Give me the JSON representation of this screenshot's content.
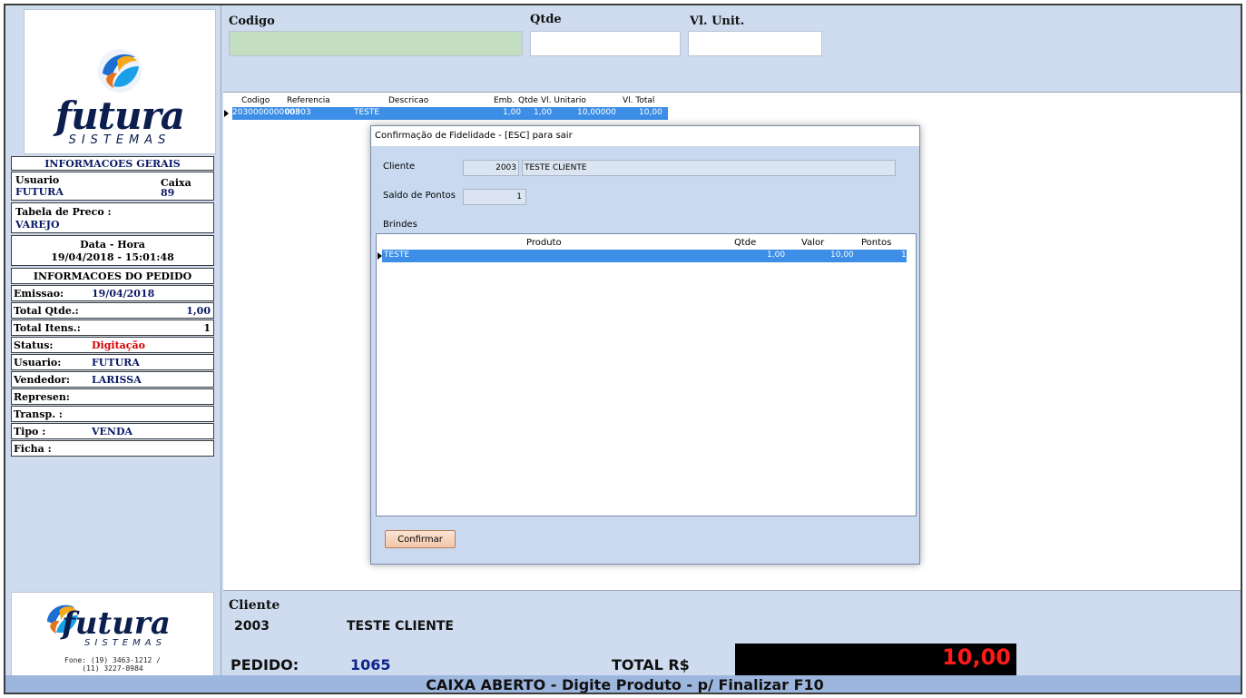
{
  "brand": {
    "name": "futura",
    "tagline": "SISTEMAS",
    "phone": "Fone: (19) 3463-1212 /",
    "phone2": "(11) 3227-8984"
  },
  "info_gerais": {
    "title": "INFORMACOES GERAIS",
    "usuario_label": "Usuario",
    "usuario": "FUTURA",
    "caixa_label": "Caixa",
    "caixa": "89",
    "tabela_label": "Tabela de Preco :",
    "tabela": "VAREJO",
    "datahora_label": "Data - Hora",
    "datahora": "19/04/2018 - 15:01:48"
  },
  "info_pedido": {
    "title": "INFORMACOES DO PEDIDO",
    "rows": [
      {
        "label": "Emissao:",
        "value": "19/04/2018"
      },
      {
        "label": "Total Qtde.:",
        "value": "1,00"
      },
      {
        "label": "Total Itens.:",
        "value": "1"
      },
      {
        "label": "Status:",
        "value": "Digitação"
      },
      {
        "label": "Usuario:",
        "value": "FUTURA"
      },
      {
        "label": "Vendedor:",
        "value": "LARISSA"
      },
      {
        "label": "Represen:",
        "value": ""
      },
      {
        "label": "Transp. :",
        "value": ""
      },
      {
        "label": "Tipo :",
        "value": "VENDA"
      },
      {
        "label": "Ficha :",
        "value": ""
      }
    ]
  },
  "entry": {
    "codigo_label": "Codigo",
    "qtde_label": "Qtde",
    "vlunit_label": "Vl. Unit.",
    "codigo": "",
    "qtde": "",
    "vlunit": ""
  },
  "grid": {
    "headers": [
      "Codigo",
      "Referencia",
      "Descricao",
      "Emb.",
      "Qtde",
      "Vl. Unitario",
      "Vl. Total"
    ],
    "row": {
      "codigo": "2030000000003",
      "referencia": "00003",
      "descricao": "TESTE",
      "emb": "1,00",
      "qtde": "1,00",
      "vl_unitario": "10,00000",
      "vl_total": "10,00"
    }
  },
  "dialog": {
    "title": "Confirmação de Fidelidade - [ESC] para sair",
    "cliente_label": "Cliente",
    "cliente_codigo": "2003",
    "cliente_nome": "TESTE CLIENTE",
    "saldo_label": "Saldo de Pontos",
    "saldo": "1",
    "brindes_label": "Brindes",
    "table_headers": [
      "Produto",
      "Qtde",
      "Valor",
      "Pontos"
    ],
    "table_row": {
      "produto": "TESTE",
      "qtde": "1,00",
      "valor": "10,00",
      "pontos": "1"
    },
    "confirm_label": "Confirmar"
  },
  "footer": {
    "cliente_label": "Cliente",
    "cliente_codigo": "2003",
    "cliente_nome": "TESTE CLIENTE",
    "pedido_label": "PEDIDO:",
    "pedido": "1065",
    "total_label": "TOTAL R$",
    "total": "10,00",
    "status": "CAIXA ABERTO - Digite Produto - p/ Finalizar F10"
  }
}
